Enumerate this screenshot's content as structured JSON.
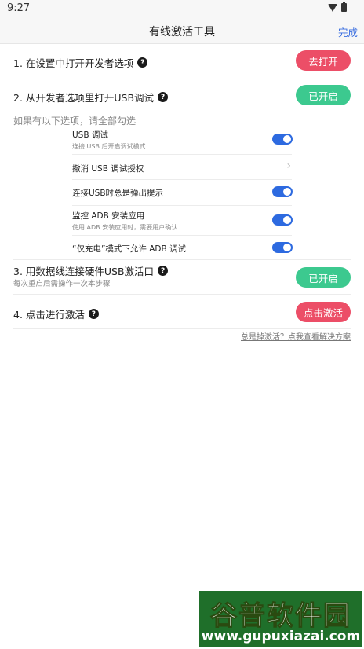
{
  "status": {
    "time": "9:27"
  },
  "header": {
    "title": "有线激活工具",
    "done_label": "完成"
  },
  "steps": [
    {
      "label": "1. 在设置中打开开发者选项",
      "button": "去打开",
      "button_color": "#ec4e67"
    },
    {
      "label": "2. 从开发者选项里打开USB调试",
      "button": "已开启",
      "button_color": "#3cc98f"
    },
    {
      "label": "3. 用数据线连接硬件USB激活口",
      "desc": "每次重启后需操作一次本步骤",
      "button": "已开启",
      "button_color": "#3cc98f"
    },
    {
      "label": "4. 点击进行激活",
      "button": "点击激活",
      "button_color": "#ec4e67"
    }
  ],
  "hint": "如果有以下选项，请全部勾选",
  "options": [
    {
      "label": "USB 调试",
      "desc": "连接 USB 后开启调试模式",
      "control": "toggle",
      "checked": true
    },
    {
      "label": "撤消 USB 调试授权",
      "desc": "",
      "control": "chevron"
    },
    {
      "label": "连接USB时总是弹出提示",
      "desc": "",
      "control": "toggle",
      "checked": true
    },
    {
      "label": "监控 ADB 安装应用",
      "desc": "使用 ADB 安装应用时，需要用户确认",
      "control": "toggle",
      "checked": true
    },
    {
      "label": "“仅充电”模式下允许 ADB 调试",
      "desc": "",
      "control": "toggle",
      "checked": true
    }
  ],
  "help_link": "总是掉激活？点我查看解决方案",
  "watermark": {
    "top": "谷普软件园",
    "bottom": "www.gupuxiazai.com"
  },
  "colors": {
    "accent": "#3b6fe0",
    "toggle_on": "#2d6ae0",
    "watermark_bg": "#1f6f2a"
  }
}
